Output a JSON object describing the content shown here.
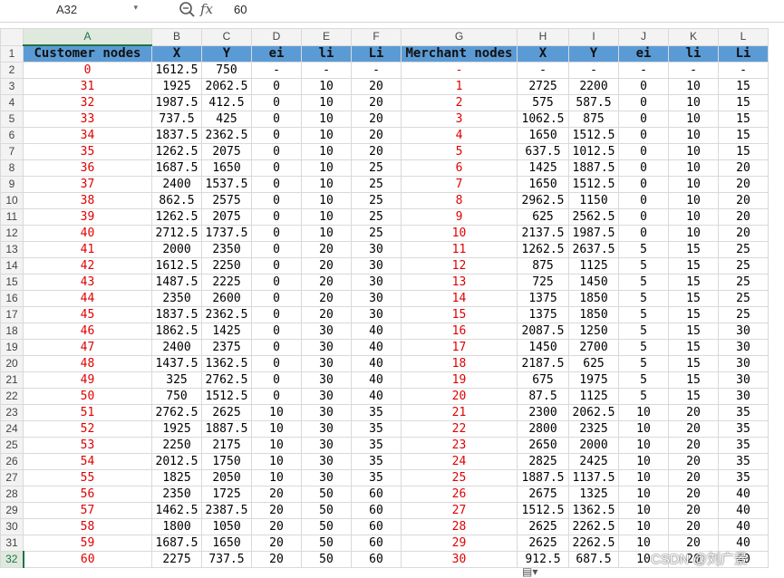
{
  "namebox": {
    "value": "A32"
  },
  "formula_bar": {
    "fx_label": "fx",
    "value": "60"
  },
  "columns": [
    "A",
    "B",
    "C",
    "D",
    "E",
    "F",
    "G",
    "H",
    "I",
    "J",
    "K",
    "L"
  ],
  "selected_column": "A",
  "header_row": [
    "Customer  nodes",
    "X",
    "Y",
    "ei",
    "li",
    "Li",
    "Merchant nodes",
    "X",
    "Y",
    "ei",
    "li",
    "Li"
  ],
  "rows": [
    [
      "0",
      "1612.5",
      "750",
      "-",
      "-",
      "-",
      "-",
      "-",
      "-",
      "-",
      "-",
      "-"
    ],
    [
      "31",
      "1925",
      "2062.5",
      "0",
      "10",
      "20",
      "1",
      "2725",
      "2200",
      "0",
      "10",
      "15"
    ],
    [
      "32",
      "1987.5",
      "412.5",
      "0",
      "10",
      "20",
      "2",
      "575",
      "587.5",
      "0",
      "10",
      "15"
    ],
    [
      "33",
      "737.5",
      "425",
      "0",
      "10",
      "20",
      "3",
      "1062.5",
      "875",
      "0",
      "10",
      "15"
    ],
    [
      "34",
      "1837.5",
      "2362.5",
      "0",
      "10",
      "20",
      "4",
      "1650",
      "1512.5",
      "0",
      "10",
      "15"
    ],
    [
      "35",
      "1262.5",
      "2075",
      "0",
      "10",
      "20",
      "5",
      "637.5",
      "1012.5",
      "0",
      "10",
      "15"
    ],
    [
      "36",
      "1687.5",
      "1650",
      "0",
      "10",
      "25",
      "6",
      "1425",
      "1887.5",
      "0",
      "10",
      "20"
    ],
    [
      "37",
      "2400",
      "1537.5",
      "0",
      "10",
      "25",
      "7",
      "1650",
      "1512.5",
      "0",
      "10",
      "20"
    ],
    [
      "38",
      "862.5",
      "2575",
      "0",
      "10",
      "25",
      "8",
      "2962.5",
      "1150",
      "0",
      "10",
      "20"
    ],
    [
      "39",
      "1262.5",
      "2075",
      "0",
      "10",
      "25",
      "9",
      "625",
      "2562.5",
      "0",
      "10",
      "20"
    ],
    [
      "40",
      "2712.5",
      "1737.5",
      "0",
      "10",
      "25",
      "10",
      "2137.5",
      "1987.5",
      "0",
      "10",
      "20"
    ],
    [
      "41",
      "2000",
      "2350",
      "0",
      "20",
      "30",
      "11",
      "1262.5",
      "2637.5",
      "5",
      "15",
      "25"
    ],
    [
      "42",
      "1612.5",
      "2250",
      "0",
      "20",
      "30",
      "12",
      "875",
      "1125",
      "5",
      "15",
      "25"
    ],
    [
      "43",
      "1487.5",
      "2225",
      "0",
      "20",
      "30",
      "13",
      "725",
      "1450",
      "5",
      "15",
      "25"
    ],
    [
      "44",
      "2350",
      "2600",
      "0",
      "20",
      "30",
      "14",
      "1375",
      "1850",
      "5",
      "15",
      "25"
    ],
    [
      "45",
      "1837.5",
      "2362.5",
      "0",
      "20",
      "30",
      "15",
      "1375",
      "1850",
      "5",
      "15",
      "25"
    ],
    [
      "46",
      "1862.5",
      "1425",
      "0",
      "30",
      "40",
      "16",
      "2087.5",
      "1250",
      "5",
      "15",
      "30"
    ],
    [
      "47",
      "2400",
      "2375",
      "0",
      "30",
      "40",
      "17",
      "1450",
      "2700",
      "5",
      "15",
      "30"
    ],
    [
      "48",
      "1437.5",
      "1362.5",
      "0",
      "30",
      "40",
      "18",
      "2187.5",
      "625",
      "5",
      "15",
      "30"
    ],
    [
      "49",
      "325",
      "2762.5",
      "0",
      "30",
      "40",
      "19",
      "675",
      "1975",
      "5",
      "15",
      "30"
    ],
    [
      "50",
      "750",
      "1512.5",
      "0",
      "30",
      "40",
      "20",
      "87.5",
      "1125",
      "5",
      "15",
      "30"
    ],
    [
      "51",
      "2762.5",
      "2625",
      "10",
      "30",
      "35",
      "21",
      "2300",
      "2062.5",
      "10",
      "20",
      "35"
    ],
    [
      "52",
      "1925",
      "1887.5",
      "10",
      "30",
      "35",
      "22",
      "2800",
      "2325",
      "10",
      "20",
      "35"
    ],
    [
      "53",
      "2250",
      "2175",
      "10",
      "30",
      "35",
      "23",
      "2650",
      "2000",
      "10",
      "20",
      "35"
    ],
    [
      "54",
      "2012.5",
      "1750",
      "10",
      "30",
      "35",
      "24",
      "2825",
      "2425",
      "10",
      "20",
      "35"
    ],
    [
      "55",
      "1825",
      "2050",
      "10",
      "30",
      "35",
      "25",
      "1887.5",
      "1137.5",
      "10",
      "20",
      "35"
    ],
    [
      "56",
      "2350",
      "1725",
      "20",
      "50",
      "60",
      "26",
      "2675",
      "1325",
      "10",
      "20",
      "40"
    ],
    [
      "57",
      "1462.5",
      "2387.5",
      "20",
      "50",
      "60",
      "27",
      "1512.5",
      "1362.5",
      "10",
      "20",
      "40"
    ],
    [
      "58",
      "1800",
      "1050",
      "20",
      "50",
      "60",
      "28",
      "2625",
      "2262.5",
      "10",
      "20",
      "40"
    ],
    [
      "59",
      "1687.5",
      "1650",
      "20",
      "50",
      "60",
      "29",
      "2625",
      "2262.5",
      "10",
      "20",
      "40"
    ],
    [
      "60",
      "2275",
      "737.5",
      "20",
      "50",
      "60",
      "30",
      "912.5",
      "687.5",
      "10",
      "20",
      "40"
    ]
  ],
  "watermark": "CSDN @刘广景",
  "icons": {
    "zoom": "zoom-icon",
    "dropdown": "chevron-down-icon",
    "paste_options": "paste-options-icon"
  },
  "colors": {
    "header_fill": "#5b9bd5",
    "node_id_text": "#e00000",
    "selection": "#217346"
  }
}
